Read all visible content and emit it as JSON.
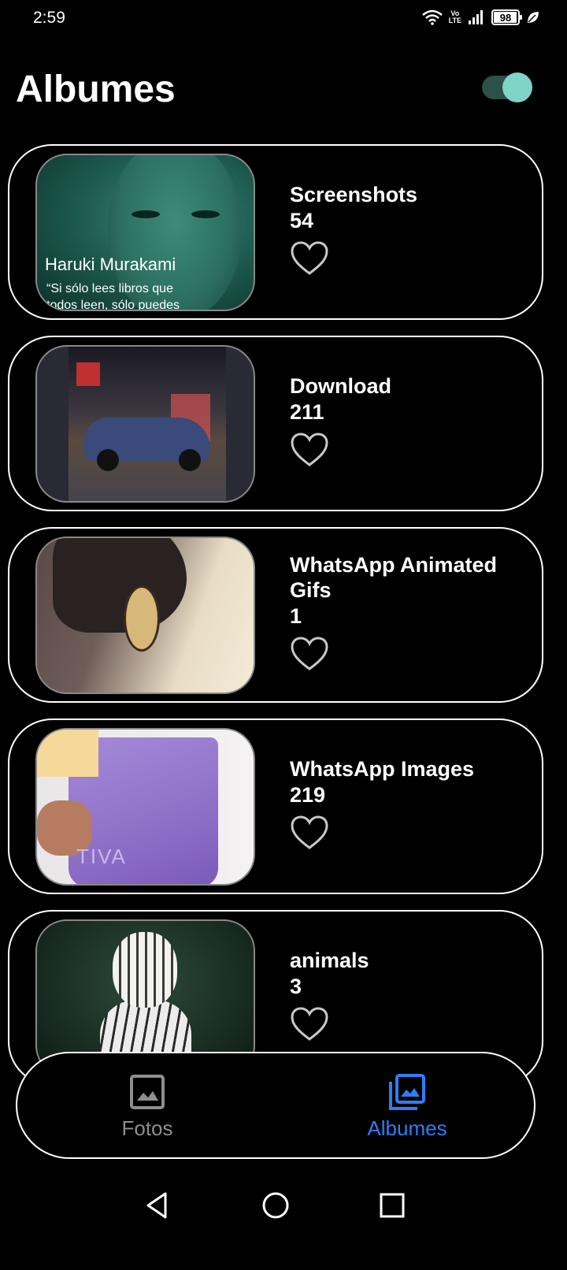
{
  "status_bar": {
    "time": "2:59",
    "volte_top": "Vo",
    "volte_bottom": "LTE",
    "battery": "98",
    "icons": [
      "wifi-icon",
      "volte-icon",
      "signal-icon",
      "battery-icon",
      "leaf-icon"
    ]
  },
  "header": {
    "title": "Albumes",
    "toggle_on": true,
    "toggle_color": "#7fd3c7"
  },
  "albums": [
    {
      "name": "Screenshots",
      "count": "54",
      "thumb_caption_title": "Haruki Murakami",
      "thumb_caption_quote_1": "“Si sólo lees libros que",
      "thumb_caption_quote_2": "todos leen, sólo puedes"
    },
    {
      "name": "Download",
      "count": "211"
    },
    {
      "name": "WhatsApp Animated Gifs",
      "count": "1"
    },
    {
      "name": "WhatsApp Images",
      "count": "219",
      "thumb_text": "TIVA"
    },
    {
      "name": "animals",
      "count": "3"
    }
  ],
  "bottom_nav": {
    "fotos_label": "Fotos",
    "albumes_label": "Albumes",
    "active": "albumes",
    "active_color": "#2f7df6",
    "inactive_color": "#8e8e8e"
  },
  "system_nav": [
    "back-icon",
    "home-icon",
    "recents-icon"
  ]
}
